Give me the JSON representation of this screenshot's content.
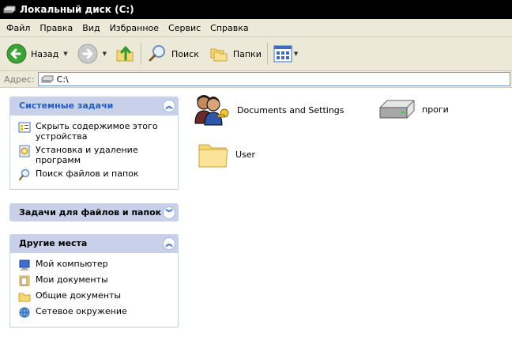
{
  "window": {
    "title": "Локальный диск (C:)"
  },
  "menu": [
    "Файл",
    "Правка",
    "Вид",
    "Избранное",
    "Сервис",
    "Справка"
  ],
  "toolbar": {
    "back": "Назад",
    "search": "Поиск",
    "folders": "Папки"
  },
  "address": {
    "label": "Адрес:",
    "value": "C:\\"
  },
  "tasks": {
    "system": {
      "title": "Системные задачи",
      "items": [
        "Скрыть содержимое этого устройства",
        "Установка и удаление программ",
        "Поиск файлов и папок"
      ]
    },
    "file": {
      "title": "Задачи для файлов и папок"
    },
    "other": {
      "title": "Другие места",
      "items": [
        "Мой компьютер",
        "Мои документы",
        "Общие документы",
        "Сетевое окружение"
      ]
    }
  },
  "files": [
    {
      "name": "Documents and Settings",
      "icon": "users-folder-icon"
    },
    {
      "name": "проги",
      "icon": "drive-icon"
    },
    {
      "name": "User",
      "icon": "folder-icon"
    }
  ]
}
